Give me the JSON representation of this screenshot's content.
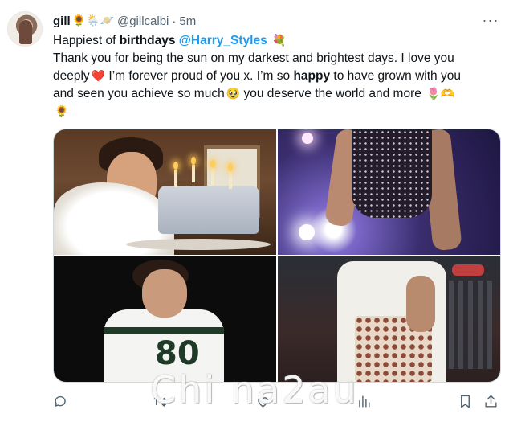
{
  "tweet": {
    "display_name": "gill",
    "name_emojis": "🌻🌦️🪐",
    "handle": "@gillcalbi",
    "separator": "·",
    "time": "5m",
    "more_label": "···",
    "text": {
      "l1_a": "Happiest of ",
      "l1_bold": "birthdays",
      "l1_space": " ",
      "l1_mention": "@Harry_Styles",
      "l1_emoji": " 💐",
      "l2": "Thank you for being the sun on my darkest and brightest days. I love you",
      "l3_a": "deeply",
      "l3_emoji": "❤️",
      "l3_b": " I’m forever proud of you x. I’m so ",
      "l3_bold": "happy",
      "l3_c": " to have grown with you",
      "l4_a": "and seen you achieve so much",
      "l4_emoji": "🥹",
      "l4_b": " you deserve the world and more ",
      "l4_emoji2": "🌷🫶",
      "l5": "🌻"
    },
    "media": {
      "photos": [
        {
          "description": "birthday-cake"
        },
        {
          "description": "stage-performer"
        },
        {
          "description": "jersey"
        },
        {
          "description": "heart-top"
        }
      ],
      "jersey_number": "80"
    },
    "actions": {
      "reply": "",
      "retweet": "",
      "like": "",
      "views": "",
      "bookmark": "",
      "share": ""
    }
  },
  "watermark": "Chi na2au",
  "colors": {
    "link": "#1d9bf0",
    "muted": "#536471",
    "text": "#0f1419"
  }
}
